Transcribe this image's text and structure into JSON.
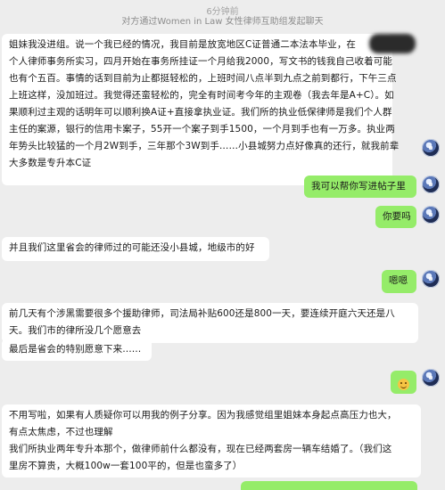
{
  "header": {
    "time": "6分钟前",
    "notice": "对方通过Women in Law 女性律师互助组发起聊天"
  },
  "messages": [
    {
      "side": "in",
      "lines": [
        "姐妹我没进组。说一个我已经的情况，我目前是放宽地区C证普通二本法本毕业，在",
        "个人律师事务所实习，四月开始在事务所挂证一个月给我2000，写文书的钱我自己收着可能",
        "也有个五百。事情的话到目前为止都挺轻松的，上班时间八点半到九点之前到都行，下午三点",
        "上班这样，没加班过。我觉得还蛮轻松的，完全有时间考今年的主观卷（我去年是A+C）。如",
        "果顺利过主观的话明年可以顺利换A证+直接拿执业证。我们所的执业低保律师是我们个人群",
        "主任的案源，银行的信用卡案子，55开一个案子到手1500，一个月到手也有一万多。执业两",
        "年势头比较猛的一个月2W到手，三年那个3W到手……小县城努力点好像真的还行，就我前辈",
        "大多数是专升本C证"
      ]
    },
    {
      "side": "out",
      "lines": [
        "我可以帮你写进帖子里"
      ]
    },
    {
      "side": "out",
      "lines": [
        "你要吗"
      ]
    },
    {
      "side": "in",
      "lines": [
        "并且我们这里省会的律师过的可能还没小县城，地级市的好"
      ]
    },
    {
      "side": "out",
      "lines": [
        "嗯嗯"
      ]
    },
    {
      "side": "in",
      "lines": [
        "前几天有个涉黑需要很多个援助律师，司法局补贴600还是800一天，要连续开庭六天还是八",
        "天。我们市的律所没几个愿意去"
      ]
    },
    {
      "side": "in",
      "lines": [
        "最后是省会的特别愿意下来……"
      ]
    },
    {
      "side": "out",
      "lines": [
        "😂"
      ]
    },
    {
      "side": "in",
      "lines": [
        "不用写啦，如果有人质疑你可以用我的例子分享。因为我感觉组里姐妹本身起点高压力也大，",
        "有点太焦虑，不过也理解",
        "我们所执业两年专升本那个，做律师前什么都没有，现在已经两套房一辆车结婚了。（我们这",
        "里房不算贵，大概100w一套100平的，但是也蛮多了）"
      ]
    }
  ],
  "colors": {
    "background": "#ededed",
    "incoming_bubble": "#ffffff",
    "outgoing_bubble": "#95ec69"
  },
  "icons": {
    "avatar": "user-avatar-icon",
    "redaction": "redaction-blur",
    "emoji": "laughing-emoji-icon"
  }
}
